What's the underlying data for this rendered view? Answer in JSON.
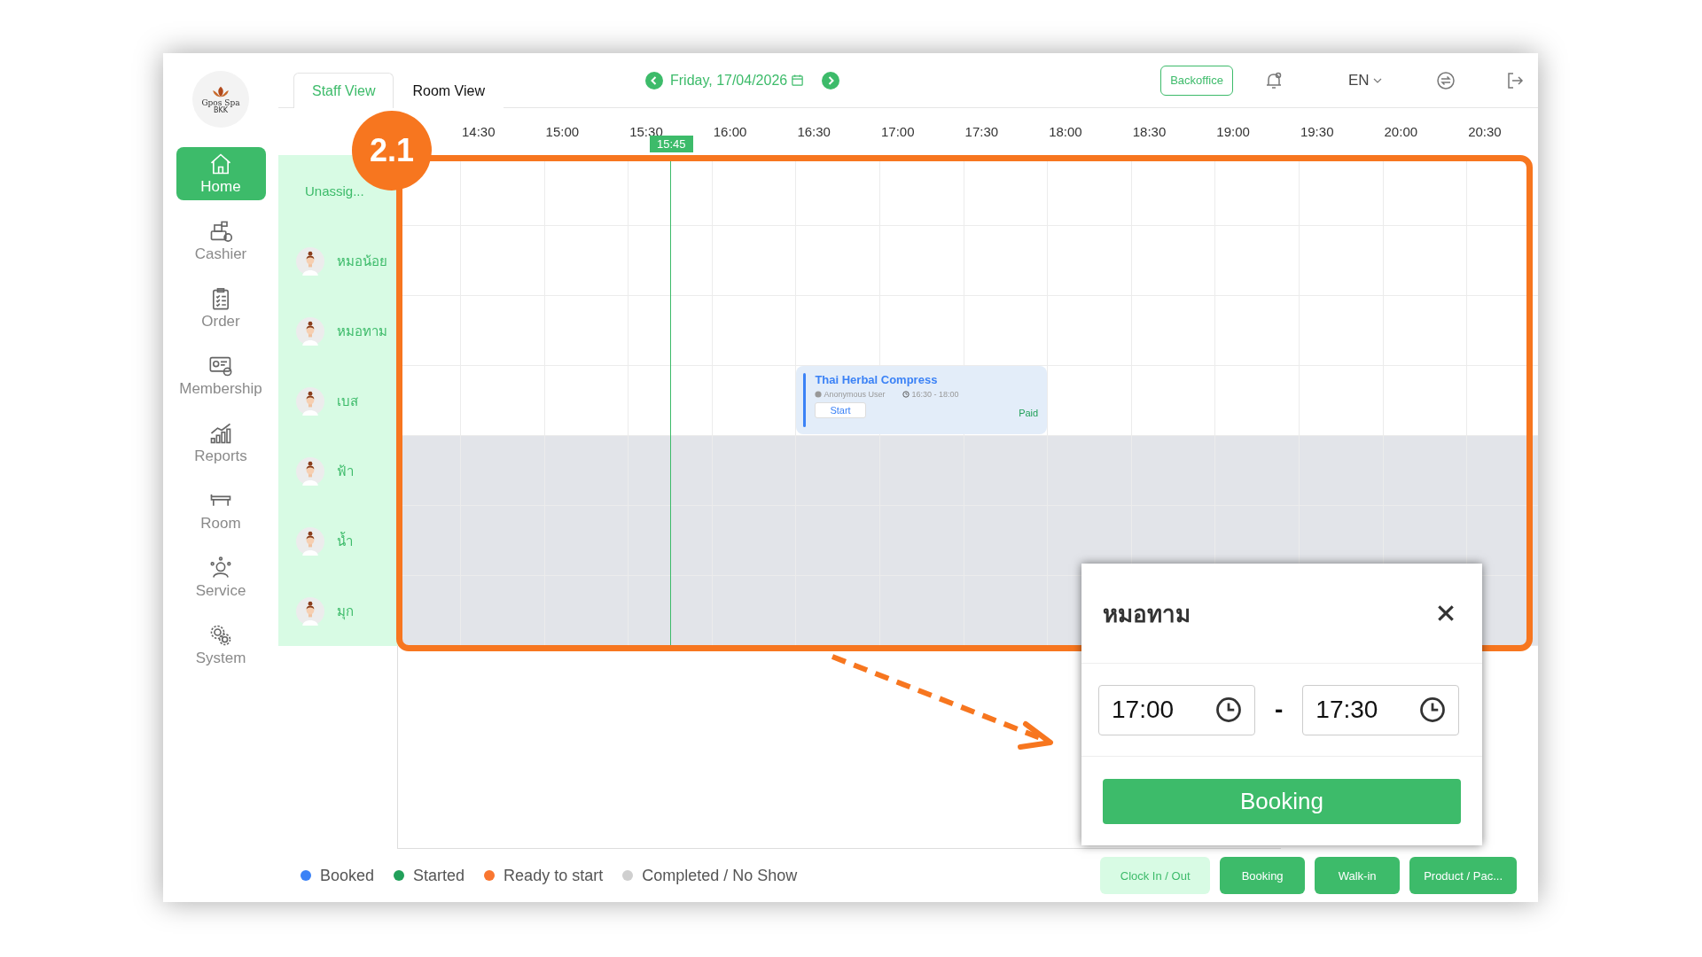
{
  "logo": {
    "name": "Gpos Spa",
    "sub": "BKK"
  },
  "sidebar": {
    "items": [
      {
        "kind": "home",
        "label": "Home",
        "selected": true
      },
      {
        "kind": "cashier",
        "label": "Cashier",
        "selected": false
      },
      {
        "kind": "order",
        "label": "Order",
        "selected": false
      },
      {
        "kind": "membership",
        "label": "Membership",
        "selected": false
      },
      {
        "kind": "reports",
        "label": "Reports",
        "selected": false
      },
      {
        "kind": "room",
        "label": "Room",
        "selected": false
      },
      {
        "kind": "service",
        "label": "Service",
        "selected": false
      },
      {
        "kind": "system",
        "label": "System",
        "selected": false
      }
    ]
  },
  "tabs": [
    {
      "label": "Staff View",
      "selected": true
    },
    {
      "label": "Room View",
      "selected": false
    }
  ],
  "date": "Friday, 17/04/2026",
  "top_actions": {
    "backoffice": "Backoffice",
    "language": "EN"
  },
  "timeline": {
    "times": [
      "14:30",
      "15:00",
      "15:30",
      "16:00",
      "16:30",
      "17:00",
      "17:30",
      "18:00",
      "18:30",
      "19:00",
      "19:30",
      "20:00",
      "20:30"
    ],
    "now": "15:45"
  },
  "unassigned_label": "Unassig...",
  "staff": [
    {
      "name": "หมอน้อย",
      "available": true
    },
    {
      "name": "หมอทาม",
      "available": true
    },
    {
      "name": "เบส",
      "available": true,
      "bookings": [
        {
          "title": "Thai Herbal Compress",
          "customer": "Anonymous User",
          "time": "16:30 - 18:00",
          "action": "Start",
          "payment": "Paid",
          "color": "#3b82f6"
        }
      ]
    },
    {
      "name": "ฟ้า",
      "available": false
    },
    {
      "name": "น้ำ",
      "available": false
    },
    {
      "name": "มุก",
      "available": false
    }
  ],
  "legend": [
    {
      "label": "Booked",
      "color": "#3b82f6"
    },
    {
      "label": "Started",
      "color": "#22a05a"
    },
    {
      "label": "Ready to start",
      "color": "#f97630"
    },
    {
      "label": "Completed / No Show",
      "color": "#cfcfcf"
    }
  ],
  "actions": [
    {
      "label": "Clock In / Out",
      "kind": "secondary"
    },
    {
      "label": "Booking",
      "kind": "primary"
    },
    {
      "label": "Walk-in",
      "kind": "primary"
    },
    {
      "label": "Product / Pac...",
      "kind": "primary"
    }
  ],
  "annotation": {
    "label": "2.1"
  },
  "popup": {
    "title": "หมอทาม",
    "start": "17:00",
    "separator": "-",
    "end": "17:30",
    "button": "Booking"
  }
}
